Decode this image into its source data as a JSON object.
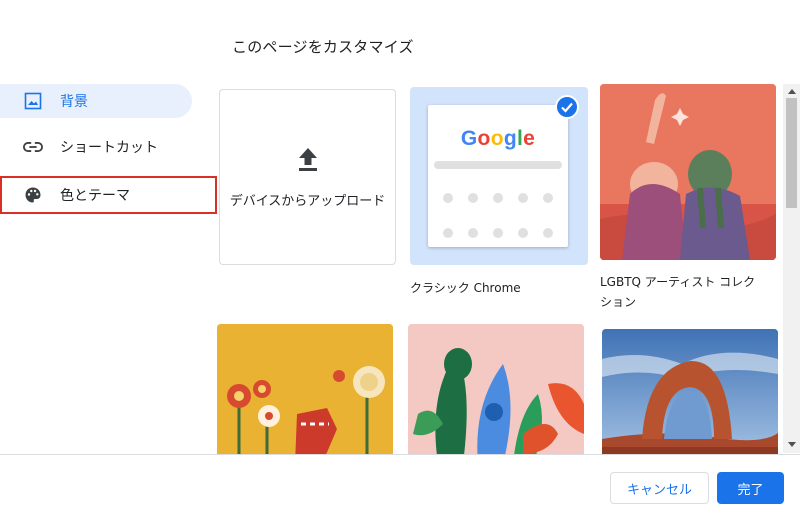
{
  "dialog": {
    "title": "このページをカスタマイズ"
  },
  "sidebar": {
    "items": [
      {
        "label": "背景",
        "icon": "image-icon",
        "selected": true
      },
      {
        "label": "ショートカット",
        "icon": "link-icon",
        "selected": false
      },
      {
        "label": "色とテーマ",
        "icon": "palette-icon",
        "selected": false
      }
    ]
  },
  "grid": {
    "upload_label": "デバイスからアップロード",
    "classic_label": "クラシック Chrome",
    "collection_label_line1": "LGBTQ アーティスト コレク",
    "collection_label_line2": "ション",
    "google_logo_text": "Google"
  },
  "footer": {
    "cancel_label": "キャンセル",
    "done_label": "完了"
  },
  "colors": {
    "accent": "#1a73e8",
    "selected_bg": "#e8f0fe",
    "highlight_border": "#d93025"
  }
}
